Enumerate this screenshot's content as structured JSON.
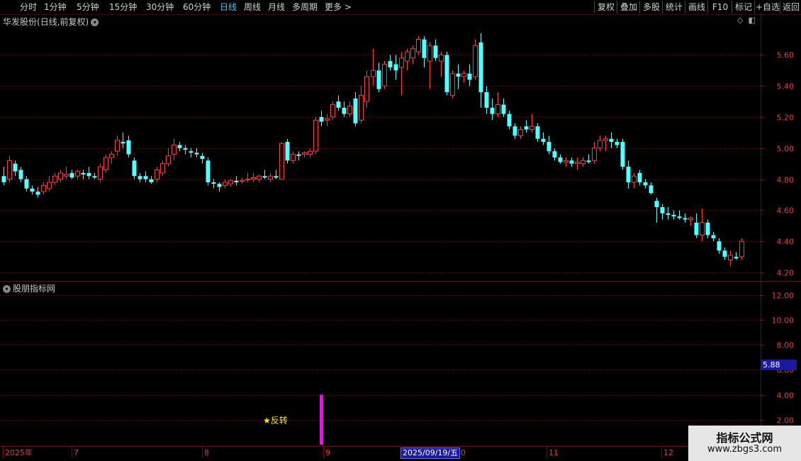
{
  "toolbar": {
    "periods": [
      "分时",
      "1分钟",
      "5分钟",
      "15分钟",
      "30分钟",
      "60分钟",
      "日线",
      "周线",
      "月线",
      "多周期",
      "更多 >"
    ],
    "active_period": "日线",
    "buttons": [
      "复权",
      "叠加",
      "多股",
      "统计",
      "画线",
      "F10",
      "标记",
      "+自选",
      "返回"
    ]
  },
  "stock": {
    "name": "华发股份",
    "mode": "(日线,前复权)"
  },
  "indicator": {
    "name": "股朋指标网",
    "signal_label": "★反转",
    "current_value": "5.88"
  },
  "price_axis": [
    "5.60",
    "5.40",
    "5.20",
    "5.00",
    "4.80",
    "4.60",
    "4.40",
    "4.20"
  ],
  "indicator_axis": [
    "12.00",
    "10.00",
    "8.00",
    "6.00",
    "4.00",
    "2.00"
  ],
  "time_axis": [
    "2025年",
    "7",
    "8",
    "9",
    "10",
    "11",
    "12"
  ],
  "crosshair_date": "2025/09/19/五",
  "watermark": {
    "title": "指标公式网",
    "url": "www.zbgs3.com"
  },
  "colors": {
    "up": "#ff3b3b",
    "down": "#54ffff",
    "signal": "#ff00ff",
    "grid": "#8a0000",
    "axis_text": "#e0403a"
  },
  "chart_data": {
    "type": "candlestick",
    "price_range": [
      4.15,
      5.78
    ],
    "indicator_range": [
      0,
      13
    ],
    "indicator_bar": {
      "index": 56,
      "value": 4.0,
      "label": "★反转"
    },
    "candles": [
      {
        "o": 4.82,
        "h": 4.88,
        "l": 4.76,
        "c": 4.78
      },
      {
        "o": 4.8,
        "h": 4.95,
        "l": 4.78,
        "c": 4.92
      },
      {
        "o": 4.9,
        "h": 4.92,
        "l": 4.82,
        "c": 4.85
      },
      {
        "o": 4.86,
        "h": 4.88,
        "l": 4.78,
        "c": 4.8
      },
      {
        "o": 4.8,
        "h": 4.82,
        "l": 4.72,
        "c": 4.74
      },
      {
        "o": 4.74,
        "h": 4.76,
        "l": 4.7,
        "c": 4.72
      },
      {
        "o": 4.72,
        "h": 4.75,
        "l": 4.68,
        "c": 4.7
      },
      {
        "o": 4.72,
        "h": 4.78,
        "l": 4.7,
        "c": 4.76
      },
      {
        "o": 4.74,
        "h": 4.82,
        "l": 4.72,
        "c": 4.78
      },
      {
        "o": 4.78,
        "h": 4.84,
        "l": 4.76,
        "c": 4.82
      },
      {
        "o": 4.8,
        "h": 4.86,
        "l": 4.78,
        "c": 4.84
      },
      {
        "o": 4.82,
        "h": 4.88,
        "l": 4.8,
        "c": 4.83
      },
      {
        "o": 4.84,
        "h": 4.86,
        "l": 4.8,
        "c": 4.81
      },
      {
        "o": 4.82,
        "h": 4.86,
        "l": 4.8,
        "c": 4.85
      },
      {
        "o": 4.84,
        "h": 4.86,
        "l": 4.8,
        "c": 4.83
      },
      {
        "o": 4.84,
        "h": 4.88,
        "l": 4.8,
        "c": 4.82
      },
      {
        "o": 4.82,
        "h": 4.84,
        "l": 4.8,
        "c": 4.81
      },
      {
        "o": 4.8,
        "h": 4.9,
        "l": 4.78,
        "c": 4.88
      },
      {
        "o": 4.86,
        "h": 4.96,
        "l": 4.84,
        "c": 4.94
      },
      {
        "o": 4.94,
        "h": 4.98,
        "l": 4.9,
        "c": 4.96
      },
      {
        "o": 4.98,
        "h": 5.08,
        "l": 4.95,
        "c": 5.05
      },
      {
        "o": 5.04,
        "h": 5.1,
        "l": 5.0,
        "c": 5.03
      },
      {
        "o": 5.05,
        "h": 5.08,
        "l": 4.94,
        "c": 4.96
      },
      {
        "o": 4.92,
        "h": 4.94,
        "l": 4.8,
        "c": 4.82
      },
      {
        "o": 4.82,
        "h": 4.84,
        "l": 4.78,
        "c": 4.8
      },
      {
        "o": 4.82,
        "h": 4.85,
        "l": 4.78,
        "c": 4.8
      },
      {
        "o": 4.8,
        "h": 4.82,
        "l": 4.77,
        "c": 4.78
      },
      {
        "o": 4.8,
        "h": 4.88,
        "l": 4.78,
        "c": 4.86
      },
      {
        "o": 4.84,
        "h": 4.92,
        "l": 4.82,
        "c": 4.9
      },
      {
        "o": 4.9,
        "h": 5.0,
        "l": 4.88,
        "c": 4.95
      },
      {
        "o": 4.96,
        "h": 5.06,
        "l": 4.92,
        "c": 5.02
      },
      {
        "o": 5.02,
        "h": 5.04,
        "l": 4.98,
        "c": 5.0
      },
      {
        "o": 5.0,
        "h": 5.02,
        "l": 4.96,
        "c": 4.99
      },
      {
        "o": 4.98,
        "h": 5.0,
        "l": 4.94,
        "c": 4.97
      },
      {
        "o": 4.97,
        "h": 5.0,
        "l": 4.94,
        "c": 4.96
      },
      {
        "o": 4.95,
        "h": 4.97,
        "l": 4.9,
        "c": 4.93
      },
      {
        "o": 4.92,
        "h": 4.94,
        "l": 4.76,
        "c": 4.78
      },
      {
        "o": 4.78,
        "h": 4.8,
        "l": 4.74,
        "c": 4.77
      },
      {
        "o": 4.77,
        "h": 4.78,
        "l": 4.72,
        "c": 4.75
      },
      {
        "o": 4.76,
        "h": 4.8,
        "l": 4.74,
        "c": 4.78
      },
      {
        "o": 4.77,
        "h": 4.8,
        "l": 4.75,
        "c": 4.79
      },
      {
        "o": 4.79,
        "h": 4.82,
        "l": 4.76,
        "c": 4.78
      },
      {
        "o": 4.79,
        "h": 4.81,
        "l": 4.77,
        "c": 4.79
      },
      {
        "o": 4.8,
        "h": 4.84,
        "l": 4.78,
        "c": 4.8
      },
      {
        "o": 4.8,
        "h": 4.84,
        "l": 4.78,
        "c": 4.81
      },
      {
        "o": 4.8,
        "h": 4.83,
        "l": 4.78,
        "c": 4.82
      },
      {
        "o": 4.82,
        "h": 4.86,
        "l": 4.8,
        "c": 4.81
      },
      {
        "o": 4.8,
        "h": 4.84,
        "l": 4.78,
        "c": 4.82
      },
      {
        "o": 4.82,
        "h": 4.86,
        "l": 4.8,
        "c": 4.81
      },
      {
        "o": 4.8,
        "h": 5.04,
        "l": 4.8,
        "c": 5.03
      },
      {
        "o": 5.04,
        "h": 5.06,
        "l": 4.9,
        "c": 4.92
      },
      {
        "o": 4.92,
        "h": 4.98,
        "l": 4.9,
        "c": 4.96
      },
      {
        "o": 4.96,
        "h": 4.98,
        "l": 4.92,
        "c": 4.95
      },
      {
        "o": 4.96,
        "h": 4.98,
        "l": 4.94,
        "c": 4.97
      },
      {
        "o": 4.96,
        "h": 5.0,
        "l": 4.94,
        "c": 4.98
      },
      {
        "o": 4.98,
        "h": 5.2,
        "l": 4.96,
        "c": 5.18
      },
      {
        "o": 5.2,
        "h": 5.24,
        "l": 5.14,
        "c": 5.17
      },
      {
        "o": 5.18,
        "h": 5.22,
        "l": 5.14,
        "c": 5.19
      },
      {
        "o": 5.2,
        "h": 5.3,
        "l": 5.18,
        "c": 5.28
      },
      {
        "o": 5.3,
        "h": 5.34,
        "l": 5.24,
        "c": 5.26
      },
      {
        "o": 5.26,
        "h": 5.3,
        "l": 5.2,
        "c": 5.22
      },
      {
        "o": 5.22,
        "h": 5.3,
        "l": 5.2,
        "c": 5.27
      },
      {
        "o": 5.32,
        "h": 5.36,
        "l": 5.14,
        "c": 5.16
      },
      {
        "o": 5.18,
        "h": 5.4,
        "l": 5.16,
        "c": 5.34
      },
      {
        "o": 5.3,
        "h": 5.5,
        "l": 5.26,
        "c": 5.46
      },
      {
        "o": 5.46,
        "h": 5.64,
        "l": 5.4,
        "c": 5.5
      },
      {
        "o": 5.5,
        "h": 5.55,
        "l": 5.36,
        "c": 5.38
      },
      {
        "o": 5.4,
        "h": 5.56,
        "l": 5.38,
        "c": 5.54
      },
      {
        "o": 5.56,
        "h": 5.6,
        "l": 5.5,
        "c": 5.52
      },
      {
        "o": 5.54,
        "h": 5.6,
        "l": 5.44,
        "c": 5.5
      },
      {
        "o": 5.52,
        "h": 5.62,
        "l": 5.34,
        "c": 5.58
      },
      {
        "o": 5.56,
        "h": 5.64,
        "l": 5.5,
        "c": 5.62
      },
      {
        "o": 5.58,
        "h": 5.66,
        "l": 5.54,
        "c": 5.64
      },
      {
        "o": 5.62,
        "h": 5.72,
        "l": 5.6,
        "c": 5.7
      },
      {
        "o": 5.7,
        "h": 5.72,
        "l": 5.52,
        "c": 5.58
      },
      {
        "o": 5.56,
        "h": 5.68,
        "l": 5.38,
        "c": 5.66
      },
      {
        "o": 5.66,
        "h": 5.7,
        "l": 5.56,
        "c": 5.58
      },
      {
        "o": 5.56,
        "h": 5.62,
        "l": 5.46,
        "c": 5.6
      },
      {
        "o": 5.6,
        "h": 5.62,
        "l": 5.34,
        "c": 5.36
      },
      {
        "o": 5.34,
        "h": 5.5,
        "l": 5.32,
        "c": 5.48
      },
      {
        "o": 5.48,
        "h": 5.54,
        "l": 5.38,
        "c": 5.46
      },
      {
        "o": 5.46,
        "h": 5.5,
        "l": 5.42,
        "c": 5.48
      },
      {
        "o": 5.48,
        "h": 5.54,
        "l": 5.4,
        "c": 5.44
      },
      {
        "o": 5.46,
        "h": 5.7,
        "l": 5.44,
        "c": 5.66
      },
      {
        "o": 5.68,
        "h": 5.74,
        "l": 5.26,
        "c": 5.36
      },
      {
        "o": 5.36,
        "h": 5.4,
        "l": 5.22,
        "c": 5.26
      },
      {
        "o": 5.26,
        "h": 5.32,
        "l": 5.18,
        "c": 5.22
      },
      {
        "o": 5.22,
        "h": 5.36,
        "l": 5.2,
        "c": 5.28
      },
      {
        "o": 5.28,
        "h": 5.32,
        "l": 5.2,
        "c": 5.22
      },
      {
        "o": 5.22,
        "h": 5.24,
        "l": 5.12,
        "c": 5.14
      },
      {
        "o": 5.14,
        "h": 5.16,
        "l": 5.06,
        "c": 5.08
      },
      {
        "o": 5.08,
        "h": 5.14,
        "l": 5.06,
        "c": 5.12
      },
      {
        "o": 5.14,
        "h": 5.18,
        "l": 5.1,
        "c": 5.12
      },
      {
        "o": 5.12,
        "h": 5.22,
        "l": 5.1,
        "c": 5.14
      },
      {
        "o": 5.14,
        "h": 5.16,
        "l": 5.04,
        "c": 5.06
      },
      {
        "o": 5.06,
        "h": 5.1,
        "l": 5.02,
        "c": 5.04
      },
      {
        "o": 5.04,
        "h": 5.08,
        "l": 4.96,
        "c": 4.98
      },
      {
        "o": 4.98,
        "h": 5.0,
        "l": 4.92,
        "c": 4.94
      },
      {
        "o": 4.94,
        "h": 4.96,
        "l": 4.9,
        "c": 4.91
      },
      {
        "o": 4.91,
        "h": 4.94,
        "l": 4.88,
        "c": 4.92
      },
      {
        "o": 4.92,
        "h": 4.94,
        "l": 4.88,
        "c": 4.9
      },
      {
        "o": 4.9,
        "h": 4.94,
        "l": 4.86,
        "c": 4.91
      },
      {
        "o": 4.9,
        "h": 4.94,
        "l": 4.88,
        "c": 4.92
      },
      {
        "o": 4.92,
        "h": 4.96,
        "l": 4.9,
        "c": 4.91
      },
      {
        "o": 4.92,
        "h": 5.04,
        "l": 4.9,
        "c": 5.0
      },
      {
        "o": 5.0,
        "h": 5.08,
        "l": 4.98,
        "c": 5.05
      },
      {
        "o": 5.05,
        "h": 5.08,
        "l": 4.98,
        "c": 5.06
      },
      {
        "o": 5.06,
        "h": 5.1,
        "l": 5.0,
        "c": 5.04
      },
      {
        "o": 5.04,
        "h": 5.06,
        "l": 5.0,
        "c": 5.02
      },
      {
        "o": 5.04,
        "h": 5.06,
        "l": 4.86,
        "c": 4.88
      },
      {
        "o": 4.88,
        "h": 4.92,
        "l": 4.74,
        "c": 4.78
      },
      {
        "o": 4.78,
        "h": 4.84,
        "l": 4.74,
        "c": 4.82
      },
      {
        "o": 4.84,
        "h": 4.86,
        "l": 4.76,
        "c": 4.78
      },
      {
        "o": 4.78,
        "h": 4.8,
        "l": 4.74,
        "c": 4.76
      },
      {
        "o": 4.76,
        "h": 4.78,
        "l": 4.7,
        "c": 4.71
      },
      {
        "o": 4.66,
        "h": 4.68,
        "l": 4.52,
        "c": 4.62
      },
      {
        "o": 4.62,
        "h": 4.64,
        "l": 4.54,
        "c": 4.58
      },
      {
        "o": 4.58,
        "h": 4.62,
        "l": 4.54,
        "c": 4.57
      },
      {
        "o": 4.57,
        "h": 4.6,
        "l": 4.54,
        "c": 4.56
      },
      {
        "o": 4.56,
        "h": 4.6,
        "l": 4.54,
        "c": 4.55
      },
      {
        "o": 4.55,
        "h": 4.58,
        "l": 4.52,
        "c": 4.54
      },
      {
        "o": 4.54,
        "h": 4.56,
        "l": 4.5,
        "c": 4.55
      },
      {
        "o": 4.52,
        "h": 4.58,
        "l": 4.42,
        "c": 4.44
      },
      {
        "o": 4.44,
        "h": 4.61,
        "l": 4.4,
        "c": 4.52
      },
      {
        "o": 4.52,
        "h": 4.54,
        "l": 4.42,
        "c": 4.44
      },
      {
        "o": 4.44,
        "h": 4.46,
        "l": 4.4,
        "c": 4.42
      },
      {
        "o": 4.4,
        "h": 4.42,
        "l": 4.32,
        "c": 4.34
      },
      {
        "o": 4.34,
        "h": 4.36,
        "l": 4.28,
        "c": 4.3
      },
      {
        "o": 4.28,
        "h": 4.34,
        "l": 4.24,
        "c": 4.31
      },
      {
        "o": 4.3,
        "h": 4.33,
        "l": 4.28,
        "c": 4.29
      },
      {
        "o": 4.3,
        "h": 4.42,
        "l": 4.28,
        "c": 4.4
      }
    ]
  }
}
